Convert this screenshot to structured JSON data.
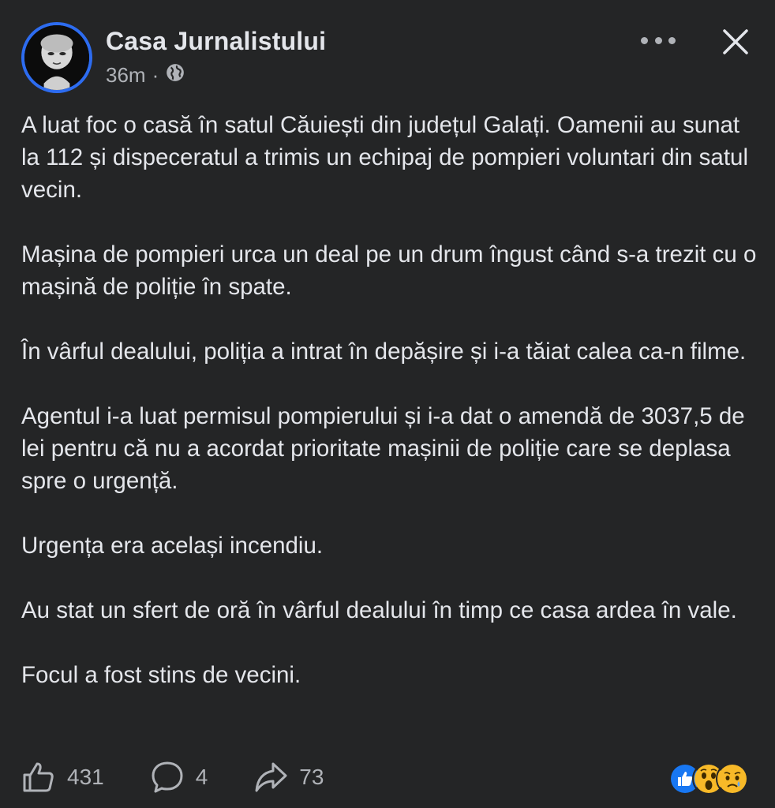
{
  "header": {
    "page_name": "Casa Jurnalistului",
    "time": "36m",
    "separator": "·",
    "privacy_icon": "globe-icon",
    "more_icon": "more-dots-icon",
    "close_icon": "close-icon"
  },
  "post": {
    "paragraphs": [
      "A luat foc o casă în satul Căuiești din județul Galați. Oamenii au sunat la 112 și dispeceratul a trimis un echipaj de pompieri voluntari din satul vecin.",
      "Mașina de pompieri urca un deal pe un drum îngust când s-a trezit cu o mașină de poliție în spate.",
      "În vârful dealului, poliția a intrat în depășire și i-a tăiat calea ca-n filme.",
      "Agentul i-a luat permisul pompierului și i-a dat o amendă de 3037,5 de lei pentru că nu a acordat prioritate mașinii de poliție care se deplasa spre o urgență.",
      "Urgența era același incendiu.",
      "Au stat un sfert de oră în vârful dealului în timp ce casa ardea în vale.",
      "Focul a fost stins de vecini."
    ]
  },
  "actions": {
    "likes": "431",
    "comments": "4",
    "shares": "73"
  },
  "reactions": [
    "like-reaction-icon",
    "wow-reaction-icon",
    "sad-reaction-icon"
  ],
  "colors": {
    "background": "#242526",
    "text": "#e4e6eb",
    "secondary_text": "#b0b3b8",
    "avatar_ring": "#2d6cf0",
    "like_blue": "#1877f2",
    "emoji_yellow": "#f7b928"
  }
}
